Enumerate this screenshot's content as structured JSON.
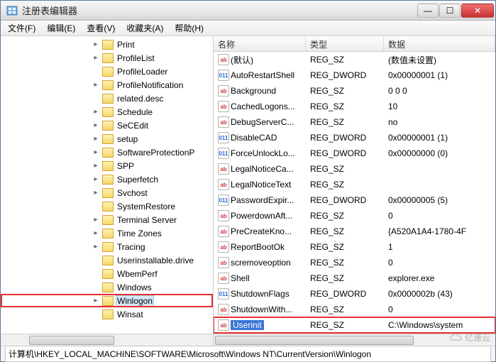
{
  "window": {
    "title": "注册表编辑器"
  },
  "menu": {
    "file": "文件(F)",
    "edit": "编辑(E)",
    "view": "查看(V)",
    "favorites": "收藏夹(A)",
    "help": "帮助(H)"
  },
  "tree": {
    "items": [
      {
        "label": "Print",
        "expand": "▸"
      },
      {
        "label": "ProfileList",
        "expand": "▸"
      },
      {
        "label": "ProfileLoader",
        "expand": ""
      },
      {
        "label": "ProfileNotification",
        "expand": "▸"
      },
      {
        "label": "related.desc",
        "expand": ""
      },
      {
        "label": "Schedule",
        "expand": "▸"
      },
      {
        "label": "SeCEdit",
        "expand": "▸"
      },
      {
        "label": "setup",
        "expand": "▸"
      },
      {
        "label": "SoftwareProtectionP",
        "expand": "▸"
      },
      {
        "label": "SPP",
        "expand": "▸"
      },
      {
        "label": "Superfetch",
        "expand": "▸"
      },
      {
        "label": "Svchost",
        "expand": "▸"
      },
      {
        "label": "SystemRestore",
        "expand": ""
      },
      {
        "label": "Terminal Server",
        "expand": "▸"
      },
      {
        "label": "Time Zones",
        "expand": "▸"
      },
      {
        "label": "Tracing",
        "expand": "▸"
      },
      {
        "label": "Userinstallable.drive",
        "expand": ""
      },
      {
        "label": "WbemPerf",
        "expand": ""
      },
      {
        "label": "Windows",
        "expand": ""
      },
      {
        "label": "Winlogon",
        "expand": "▸",
        "selected": true,
        "highlight": true
      },
      {
        "label": "Winsat",
        "expand": ""
      }
    ]
  },
  "list": {
    "columns": {
      "name": "名称",
      "type": "类型",
      "data": "数据"
    },
    "rows": [
      {
        "icon": "sz",
        "name": "(默认)",
        "type": "REG_SZ",
        "data": "(数值未设置)"
      },
      {
        "icon": "dw",
        "name": "AutoRestartShell",
        "type": "REG_DWORD",
        "data": "0x00000001 (1)"
      },
      {
        "icon": "sz",
        "name": "Background",
        "type": "REG_SZ",
        "data": "0 0 0"
      },
      {
        "icon": "sz",
        "name": "CachedLogons...",
        "type": "REG_SZ",
        "data": "10"
      },
      {
        "icon": "sz",
        "name": "DebugServerC...",
        "type": "REG_SZ",
        "data": "no"
      },
      {
        "icon": "dw",
        "name": "DisableCAD",
        "type": "REG_DWORD",
        "data": "0x00000001 (1)"
      },
      {
        "icon": "dw",
        "name": "ForceUnlockLo...",
        "type": "REG_DWORD",
        "data": "0x00000000 (0)"
      },
      {
        "icon": "sz",
        "name": "LegalNoticeCa...",
        "type": "REG_SZ",
        "data": ""
      },
      {
        "icon": "sz",
        "name": "LegalNoticeText",
        "type": "REG_SZ",
        "data": ""
      },
      {
        "icon": "dw",
        "name": "PasswordExpir...",
        "type": "REG_DWORD",
        "data": "0x00000005 (5)"
      },
      {
        "icon": "sz",
        "name": "PowerdownAft...",
        "type": "REG_SZ",
        "data": "0"
      },
      {
        "icon": "sz",
        "name": "PreCreateKno...",
        "type": "REG_SZ",
        "data": "{A520A1A4-1780-4F"
      },
      {
        "icon": "sz",
        "name": "ReportBootOk",
        "type": "REG_SZ",
        "data": "1"
      },
      {
        "icon": "sz",
        "name": "scremoveoption",
        "type": "REG_SZ",
        "data": "0"
      },
      {
        "icon": "sz",
        "name": "Shell",
        "type": "REG_SZ",
        "data": "explorer.exe"
      },
      {
        "icon": "dw",
        "name": "ShutdownFlags",
        "type": "REG_DWORD",
        "data": "0x0000002b (43)"
      },
      {
        "icon": "sz",
        "name": "ShutdownWith...",
        "type": "REG_SZ",
        "data": "0"
      },
      {
        "icon": "sz",
        "name": "Userinit",
        "type": "REG_SZ",
        "data": "C:\\Windows\\system",
        "highlight": true
      }
    ]
  },
  "status": {
    "path": "计算机\\HKEY_LOCAL_MACHINE\\SOFTWARE\\Microsoft\\Windows NT\\CurrentVersion\\Winlogon"
  },
  "watermark": "亿速云",
  "icons": {
    "sz": "ab",
    "dw": "011"
  }
}
